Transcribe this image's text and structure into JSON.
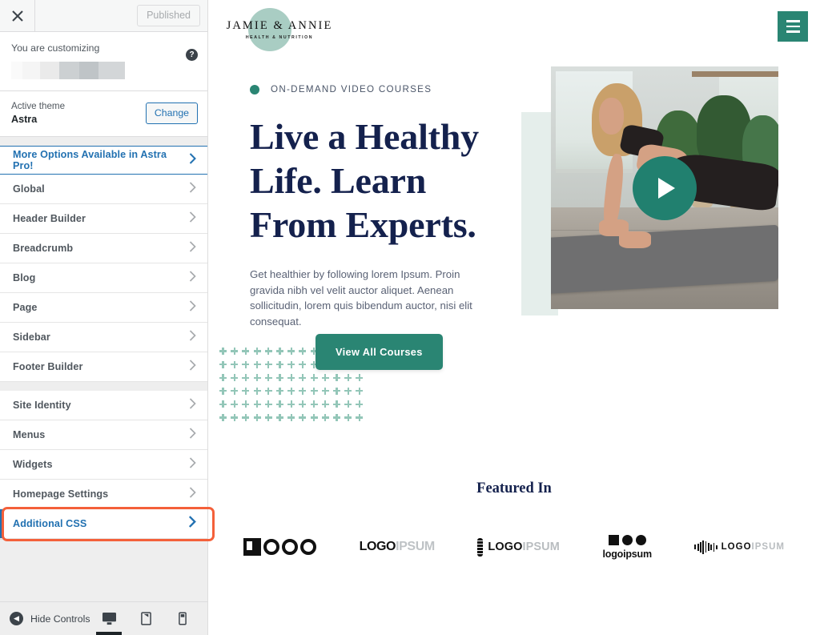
{
  "customizer": {
    "close_icon": "close-icon",
    "publish_label": "Published",
    "info_label": "You are customizing",
    "help_icon": "help-icon",
    "theme": {
      "sub_label": "Active theme",
      "name": "Astra",
      "change_label": "Change"
    },
    "groups": [
      {
        "items": [
          {
            "label": "More Options Available in Astra Pro!",
            "style": "pro"
          },
          {
            "label": "Global",
            "style": "normal"
          },
          {
            "label": "Header Builder",
            "style": "normal"
          },
          {
            "label": "Breadcrumb",
            "style": "normal"
          },
          {
            "label": "Blog",
            "style": "normal"
          },
          {
            "label": "Page",
            "style": "normal"
          },
          {
            "label": "Sidebar",
            "style": "normal"
          },
          {
            "label": "Footer Builder",
            "style": "normal"
          }
        ]
      },
      {
        "items": [
          {
            "label": "Site Identity",
            "style": "normal"
          },
          {
            "label": "Menus",
            "style": "normal"
          },
          {
            "label": "Widgets",
            "style": "normal"
          },
          {
            "label": "Homepage Settings",
            "style": "normal"
          },
          {
            "label": "Additional CSS",
            "style": "focused"
          }
        ]
      }
    ],
    "footer": {
      "hide_controls_label": "Hide Controls",
      "devices": [
        {
          "name": "desktop",
          "active": true
        },
        {
          "name": "tablet",
          "active": false
        },
        {
          "name": "mobile",
          "active": false
        }
      ]
    },
    "accent_blue": "#2271b1",
    "focus_outline": "#f4603a"
  },
  "preview": {
    "header": {
      "logo_main": "JAMIE & ANNIE",
      "logo_sub": "HEALTH & NUTRITION",
      "menu_icon": "hamburger-menu-icon"
    },
    "hero": {
      "badge": "ON-DEMAND VIDEO COURSES",
      "title": "Live a Healthy Life. Learn From Experts.",
      "paragraph": "Get healthier by following lorem Ipsum. Proin gravida nibh vel velit auctor aliquet. Aenean sollicitudin, lorem quis bibendum auctor, nisi elit consequat.",
      "cta_label": "View All Courses",
      "play_icon": "play-icon"
    },
    "featured": {
      "title": "Featured In",
      "logos": [
        {
          "name": "logo-brand-1",
          "text": "LOGO"
        },
        {
          "name": "logo-brand-2",
          "text_bold": "LOGO",
          "text_light": "IPSUM"
        },
        {
          "name": "logo-brand-3",
          "text_bold": "LOGO",
          "text_light": "IPSUM"
        },
        {
          "name": "logo-brand-4",
          "text": "logoipsum"
        },
        {
          "name": "logo-brand-5",
          "text_bold": "LOGO",
          "text_light": "IPSUM"
        }
      ]
    },
    "colors": {
      "green": "#2a8573",
      "navy": "#14214d",
      "sage": "#a9cdc3",
      "mint": "#e5eeeb"
    }
  }
}
